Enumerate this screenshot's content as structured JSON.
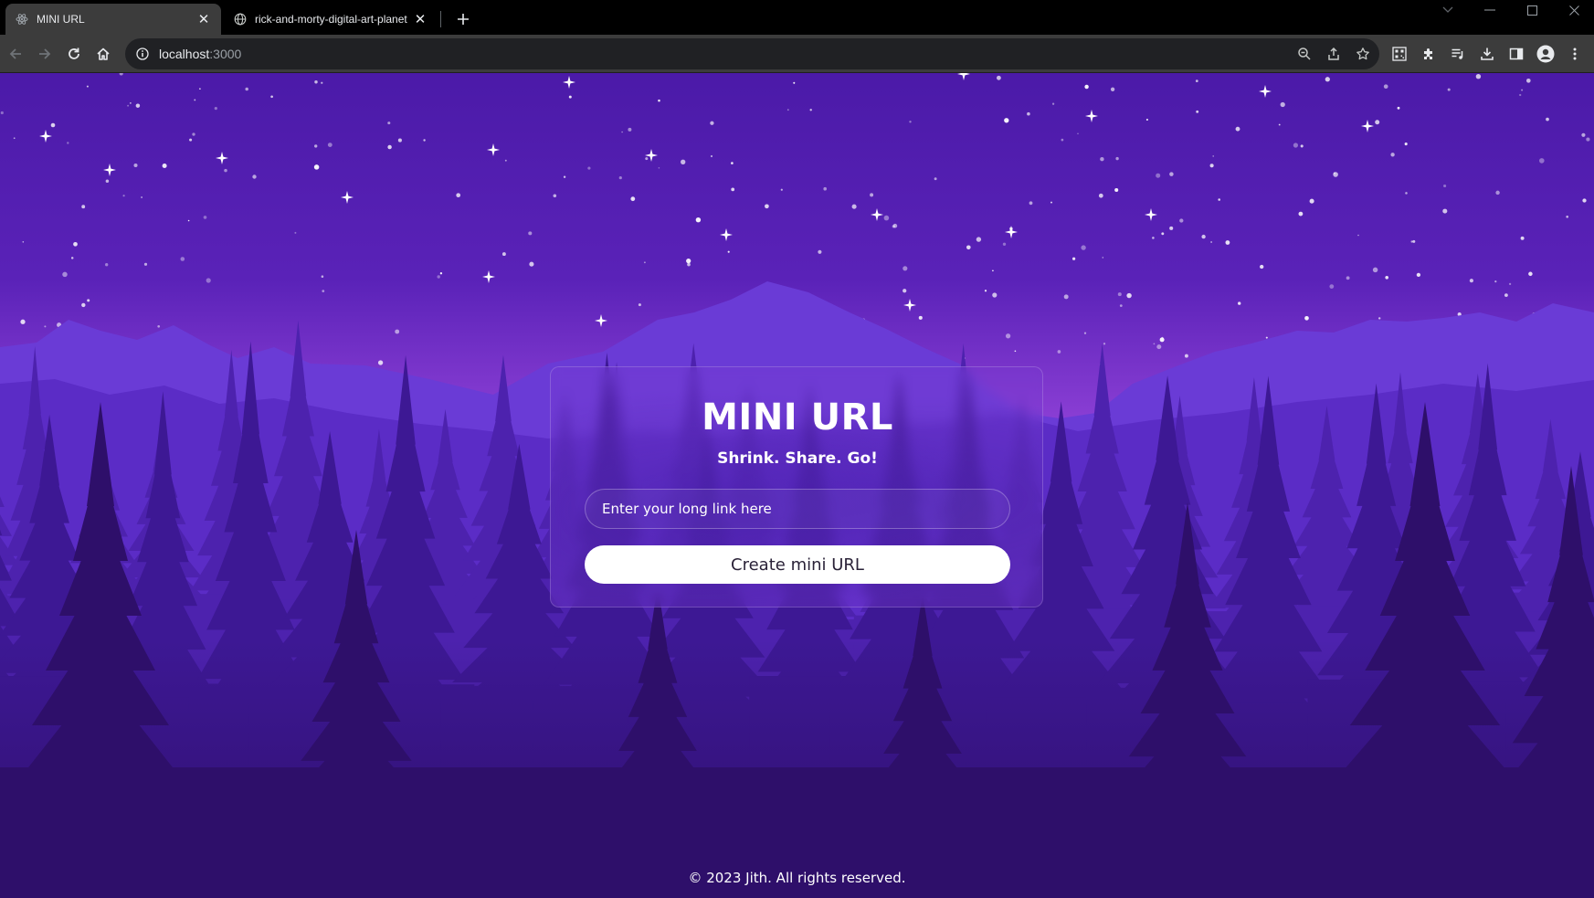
{
  "browser": {
    "tabs": [
      {
        "title": "MINI URL",
        "active": true,
        "icon": "react-icon"
      },
      {
        "title": "rick-and-morty-digital-art-planet",
        "active": false,
        "icon": "globe-icon"
      }
    ],
    "address": {
      "host": "localhost",
      "port": ":3000"
    }
  },
  "page": {
    "title": "MINI URL",
    "tagline": "Shrink. Share. Go!",
    "input_placeholder": "Enter your long link here",
    "input_value": "",
    "button_label": "Create mini URL",
    "footer": "© 2023 Jith. All rights reserved."
  },
  "colors": {
    "sky_top": "#4b1aa8",
    "sky_horizon": "#a44fe0",
    "forest_dark": "#2e0f6a",
    "button_bg": "#ffffff",
    "button_text": "#2a2238"
  }
}
